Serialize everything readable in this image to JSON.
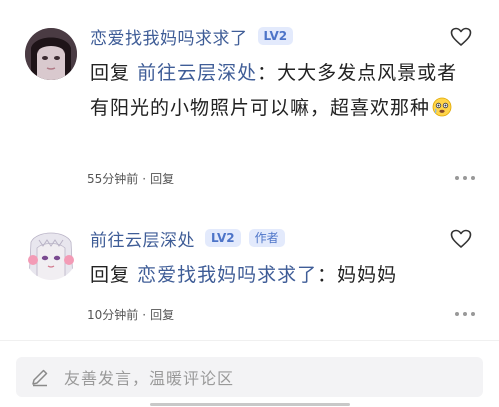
{
  "comments": [
    {
      "username": "恋爱找我妈吗求求了",
      "level": "LV2",
      "reply_prefix": "回复",
      "reply_to": "前往云层深处",
      "separator": "：",
      "text": "大大多发点风景或者有阳光的小物照片可以嘛，超喜欢那种",
      "emoji": "fearful-face-emoji",
      "time": "55分钟前",
      "dot": "·",
      "reply_action": "回复"
    },
    {
      "username": "前往云层深处",
      "level": "LV2",
      "author_badge": "作者",
      "reply_prefix": "回复",
      "reply_to": "恋爱找我妈吗求求了",
      "separator": "：",
      "text": "妈妈妈",
      "time": "10分钟前",
      "dot": "·",
      "reply_action": "回复"
    }
  ],
  "input": {
    "placeholder": "友善发言，温暖评论区"
  },
  "icons": {
    "like": "heart-outline-icon",
    "more": "more-dots-icon",
    "compose": "pen-icon"
  },
  "colors": {
    "username": "#3f5d97",
    "level_badge_bg": "#e3eafc",
    "level_badge_text": "#4d74c8",
    "input_bg": "#f3f3f5"
  }
}
